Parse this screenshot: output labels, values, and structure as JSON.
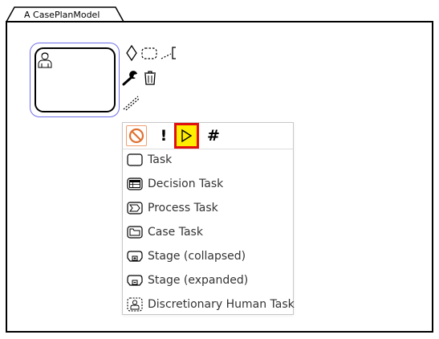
{
  "case_plan_model": {
    "label": "A CasePlanModel"
  },
  "context_pad": {
    "icons": [
      "diamond-icon",
      "dashed-box-icon",
      "connector-annotation-icon",
      "wrench-icon",
      "trash-icon",
      "dashed-connection-icon"
    ]
  },
  "replace_menu": {
    "header_buttons": [
      {
        "icon": "manual-activation-icon",
        "label": ""
      },
      {
        "icon": "required-marker",
        "label": "!"
      },
      {
        "icon": "play-icon",
        "label": ""
      },
      {
        "icon": "repetition-marker",
        "label": "#"
      }
    ],
    "entries": [
      {
        "icon": "task-icon",
        "label": "Task"
      },
      {
        "icon": "decision-task-icon",
        "label": "Decision Task"
      },
      {
        "icon": "process-task-icon",
        "label": "Process Task"
      },
      {
        "icon": "case-task-icon",
        "label": "Case Task"
      },
      {
        "icon": "stage-collapsed-icon",
        "label": "Stage (collapsed)"
      },
      {
        "icon": "stage-expanded-icon",
        "label": "Stage (expanded)"
      },
      {
        "icon": "discretionary-human-task-icon",
        "label": "Discretionary Human Task"
      }
    ]
  },
  "colors": {
    "selection": "#6f6fe8",
    "highlight_fill": "#ffee00",
    "highlight_border": "#e01010",
    "manual_activation": "#f0a070"
  }
}
